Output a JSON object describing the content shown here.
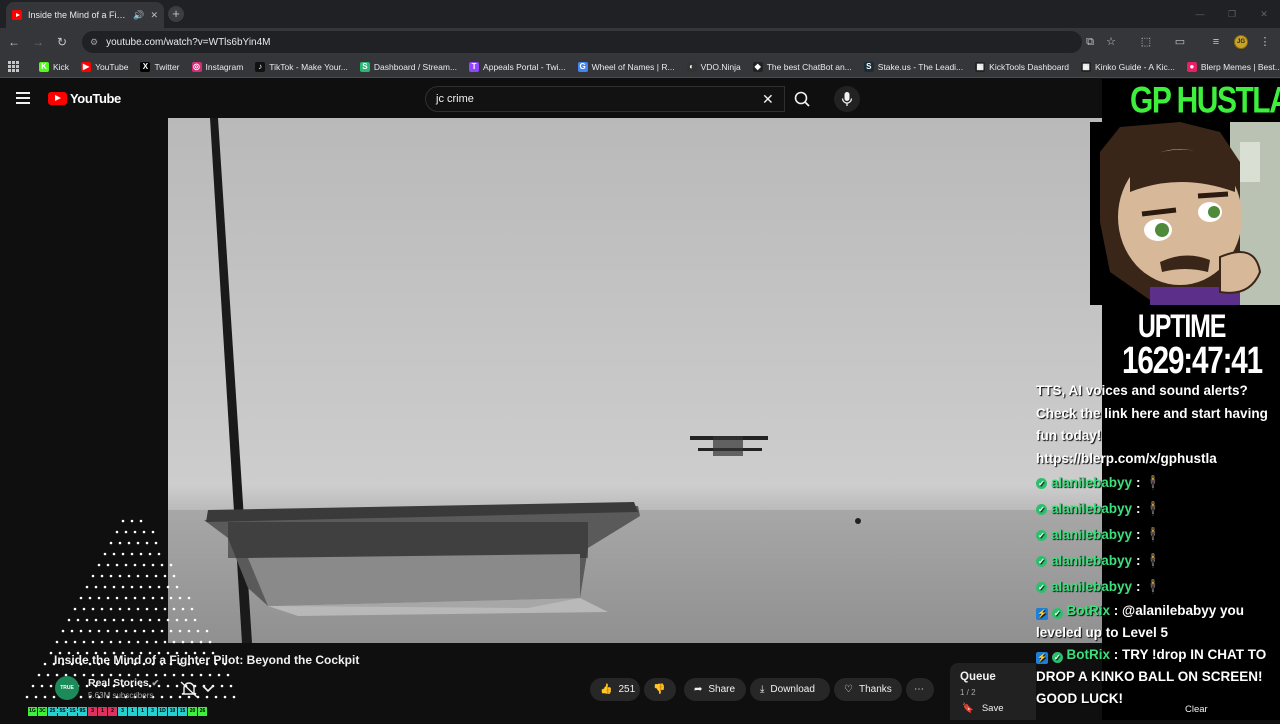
{
  "browser": {
    "tab_title": "Inside the Mind of a Fighte",
    "url": "youtube.com/watch?v=WTls6bYin4M",
    "bookmarks": [
      {
        "label": "Kick",
        "color": "#53fc18",
        "glyph": "K"
      },
      {
        "label": "YouTube",
        "color": "#ff0000",
        "glyph": "▶"
      },
      {
        "label": "Twitter",
        "color": "#000000",
        "glyph": "X"
      },
      {
        "label": "Instagram",
        "color": "#d62976",
        "glyph": "◎"
      },
      {
        "label": "TikTok - Make Your...",
        "color": "#111111",
        "glyph": "♪"
      },
      {
        "label": "Dashboard / Stream...",
        "color": "#2bb673",
        "glyph": "S"
      },
      {
        "label": "Appeals Portal - Twi...",
        "color": "#9146ff",
        "glyph": "T"
      },
      {
        "label": "Wheel of Names | R...",
        "color": "#4285f4",
        "glyph": "G"
      },
      {
        "label": "VDO.Ninja",
        "color": "#333333",
        "glyph": "◐"
      },
      {
        "label": "The best ChatBot an...",
        "color": "#222222",
        "glyph": "◆"
      },
      {
        "label": "Stake.us - The Leadi...",
        "color": "#1a2c38",
        "glyph": "S"
      },
      {
        "label": "KickTools Dashboard",
        "color": "#222222",
        "glyph": "▦"
      },
      {
        "label": "Kinko Guide - A Kic...",
        "color": "#222222",
        "glyph": "▦"
      },
      {
        "label": "Blerp Memes | Best...",
        "color": "#e91e63",
        "glyph": "●"
      }
    ]
  },
  "youtube": {
    "logo_text": "YouTube",
    "search_value": "jc crime"
  },
  "overlay": {
    "title": "GP HUSTLA",
    "uptime_label": "UPTIME",
    "uptime_value": "1629:47:41",
    "promo": "TTS, AI voices and sound alerts? Check the link here and start having fun today! https://blerp.com/x/gphustla",
    "chat": [
      {
        "user": "alanilebabyy",
        "sep": ":",
        "msg": "🕴"
      },
      {
        "user": "alanilebabyy",
        "sep": ":",
        "msg": "🕴"
      },
      {
        "user": "alanilebabyy",
        "sep": ":",
        "msg": "🕴"
      },
      {
        "user": "alanilebabyy",
        "sep": ":",
        "msg": "🕴"
      },
      {
        "user": "alanilebabyy",
        "sep": ":",
        "msg": "🕴"
      }
    ],
    "bot_messages": [
      {
        "user": "BotRix",
        "msg": ": @alanilebabyy you leveled up to Level 5"
      },
      {
        "user": "BotRix",
        "msg": ": TRY !drop IN CHAT TO DROP A KINKO BALL ON SCREEN! GOOD LUCK!"
      }
    ]
  },
  "video": {
    "title": "Inside the Mind of a Fighter Pilot: Beyond the Cockpit",
    "channel": "Real Stories",
    "subscribers": "5.63M subscribers",
    "channel_badge": "TRUE STORIES",
    "likes": "251",
    "share_label": "Share",
    "download_label": "Download",
    "thanks_label": "Thanks"
  },
  "queue": {
    "title": "Queue",
    "count": "1 / 2",
    "save_label": "Save",
    "clear_label": "Clear"
  },
  "level_bar": [
    "1G",
    "3C",
    "25",
    "5S",
    "1S",
    "9S",
    "3",
    "1",
    "2",
    "3",
    "1",
    "1",
    "3",
    "1D",
    "10",
    "15",
    "20",
    "26"
  ],
  "colors": {
    "accent_green": "#3cf03c",
    "chat_user": "#3be07c",
    "yt_red": "#ff0000"
  }
}
